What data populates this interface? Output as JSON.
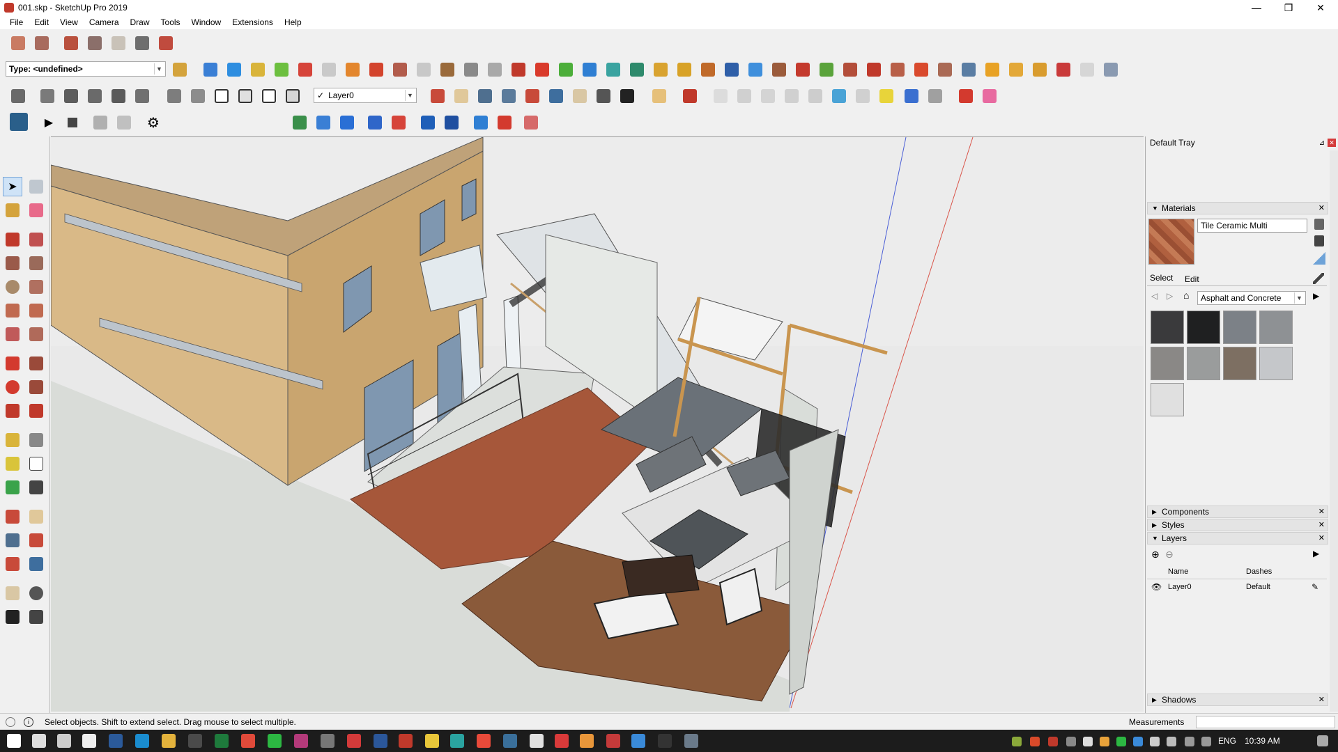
{
  "window": {
    "title": "001.skp - SketchUp Pro 2019",
    "minimize": "—",
    "restore": "❐",
    "close": "✕"
  },
  "menu": [
    "File",
    "Edit",
    "View",
    "Camera",
    "Draw",
    "Tools",
    "Window",
    "Extensions",
    "Help"
  ],
  "toolbar": {
    "type_combo": "Type: <undefined>",
    "layer_combo": "Layer0",
    "layer_check": "✓"
  },
  "tray": {
    "title": "Default Tray",
    "pin": "⊿",
    "materials": {
      "header": "Materials",
      "current_name": "Tile Ceramic Multi",
      "tabs": [
        "Select",
        "Edit"
      ],
      "library": "Asphalt and Concrete",
      "swatch_colors": [
        "#3a3a3c",
        "#1f2021",
        "#7c8187",
        "#8e9194",
        "#8a8886",
        "#9a9c9c",
        "#7d6f62",
        "#c5c7ca",
        "#e0e0e0"
      ]
    },
    "components": "Components",
    "styles": "Styles",
    "layers": {
      "header": "Layers",
      "col_name": "Name",
      "col_dashes": "Dashes",
      "row_name": "Layer0",
      "row_dashes": "Default"
    },
    "shadows": "Shadows"
  },
  "status": {
    "message": "Select objects. Shift to extend select. Drag mouse to select multiple.",
    "measurements_label": "Measurements"
  },
  "taskbar": {
    "lang": "ENG",
    "time": "10:39 AM"
  }
}
